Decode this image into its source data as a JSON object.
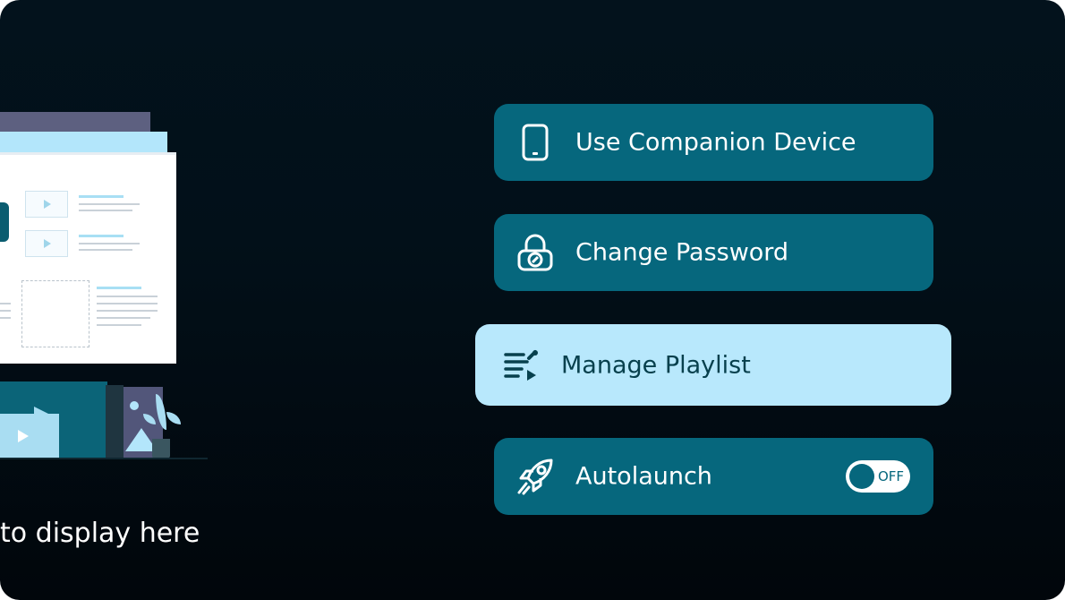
{
  "empty_state": {
    "text": "to display here"
  },
  "menu": {
    "items": [
      {
        "id": "companion",
        "label": "Use Companion Device",
        "icon": "phone-icon"
      },
      {
        "id": "password",
        "label": "Change Password",
        "icon": "lock-icon"
      },
      {
        "id": "playlist",
        "label": "Manage Playlist",
        "icon": "playlist-edit-icon",
        "focused": true
      },
      {
        "id": "autolaunch",
        "label": "Autolaunch",
        "icon": "rocket-icon",
        "toggle": {
          "state": "OFF",
          "on": false
        }
      }
    ]
  },
  "colors": {
    "background": "#021019",
    "button": "#06677d",
    "button_focused": "#b8e8fc",
    "text_on_button": "#ffffff",
    "text_on_focused": "#07404d"
  }
}
